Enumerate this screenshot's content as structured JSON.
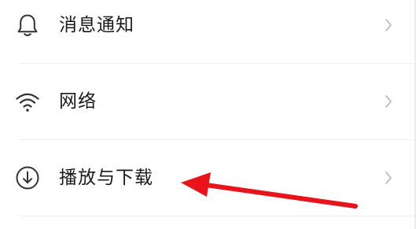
{
  "settings": {
    "items": [
      {
        "label": "消息通知",
        "icon": "bell-icon"
      },
      {
        "label": "网络",
        "icon": "wifi-icon"
      },
      {
        "label": "播放与下载",
        "icon": "download-icon"
      }
    ]
  },
  "colors": {
    "text": "#1a1a1a",
    "icon": "#333333",
    "chevron": "#b3b3b3",
    "divider": "#eeeeee",
    "annotation_arrow": "#e8141b"
  }
}
